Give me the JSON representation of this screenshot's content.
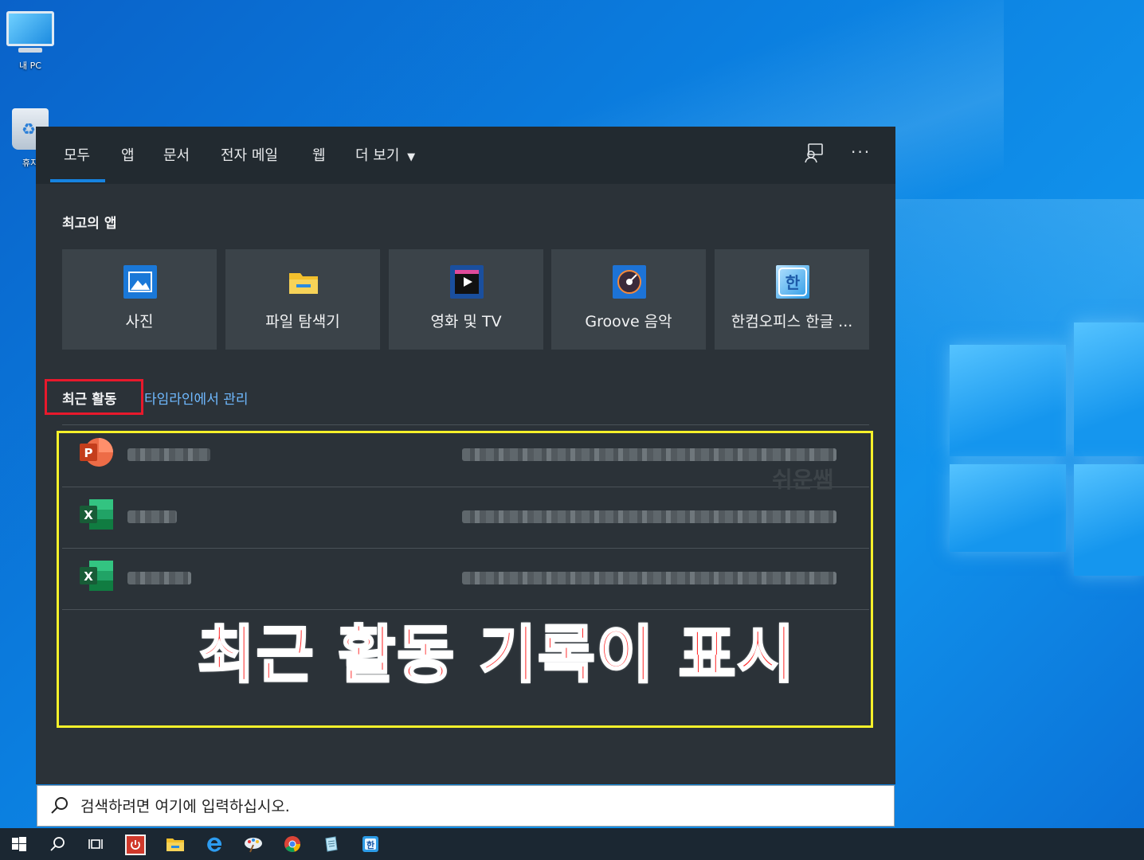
{
  "desktop": {
    "icons": [
      {
        "label": "내 PC"
      },
      {
        "label": "휴지"
      }
    ]
  },
  "search_window": {
    "tabs": [
      {
        "label": "모두"
      },
      {
        "label": "앱"
      },
      {
        "label": "문서"
      },
      {
        "label": "전자 메일"
      },
      {
        "label": "웹"
      },
      {
        "label": "더 보기"
      }
    ],
    "active_tab": "모두",
    "toolbar_icons": [
      "feedback-icon",
      "more-options-icon"
    ],
    "more_label": "···",
    "top_apps": {
      "title": "최고의 앱",
      "items": [
        {
          "label": "사진",
          "icon": "photos-icon",
          "color": "#1a78d8"
        },
        {
          "label": "파일 탐색기",
          "icon": "file-explorer-icon",
          "color": "#f3c02c"
        },
        {
          "label": "영화 및 TV",
          "icon": "movies-tv-icon",
          "color": "#1a4f9e"
        },
        {
          "label": "Groove 음악",
          "icon": "groove-music-icon",
          "color": "#1d73d6"
        },
        {
          "label": "한컴오피스 한글 ...",
          "icon": "hancom-icon",
          "color": "#2c9be6"
        }
      ]
    },
    "recent": {
      "title": "최근 활동",
      "manage_link": "타임라인에서 관리",
      "items": [
        {
          "app": "powerpoint",
          "icon": "powerpoint-icon",
          "letter": "P"
        },
        {
          "app": "excel",
          "icon": "excel-icon",
          "letter": "X"
        },
        {
          "app": "excel",
          "icon": "excel-icon",
          "letter": "X"
        }
      ],
      "watermark": "쉬운쌤"
    },
    "annotation": "최근 활동 기록이 표시"
  },
  "search_box": {
    "placeholder": "검색하려면 여기에 입력하십시오."
  },
  "taskbar": {
    "items": [
      "start-icon",
      "search-icon",
      "task-view-icon",
      "power-app-icon",
      "file-explorer-icon",
      "edge-icon",
      "paint-icon",
      "chrome-icon",
      "notepad-icon",
      "hancom-icon"
    ]
  },
  "colors": {
    "accent": "#1683e0",
    "link": "#6fb9ff",
    "panel": "#2b3238",
    "annotation_red": "#ff1f1f",
    "highlight_yellow": "#f6f12a"
  }
}
